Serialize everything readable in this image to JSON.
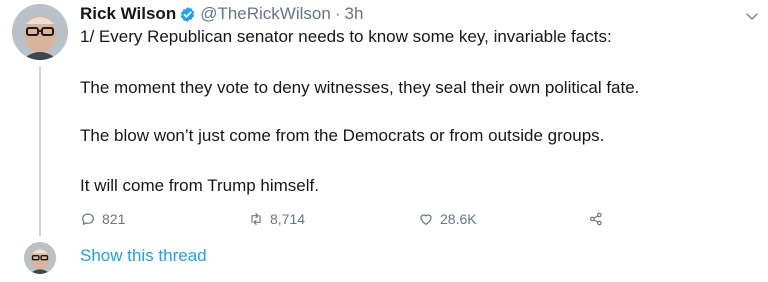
{
  "tweet": {
    "author_name": "Rick Wilson",
    "handle": "@TheRickWilson",
    "separator": "·",
    "time": "3h",
    "lines": [
      "1/ Every Republican senator needs to know some key, invariable facts:",
      "The moment they vote to deny witnesses, they seal their own political fate.",
      "The blow won’t just come from the Democrats or from outside groups.",
      "It will come from Trump himself."
    ],
    "actions": {
      "replies": "821",
      "retweets": "8,714",
      "likes": "28.6K"
    }
  },
  "thread": {
    "show_label": "Show this thread"
  },
  "icons": {
    "verified": "verified-badge-icon",
    "menu": "chevron-down-icon",
    "reply": "reply-icon",
    "retweet": "retweet-icon",
    "like": "heart-icon",
    "share": "share-icon"
  },
  "colors": {
    "accent": "#1da1f2",
    "muted": "#657786",
    "text": "#14171a",
    "thread_line": "#ccd6dd"
  }
}
